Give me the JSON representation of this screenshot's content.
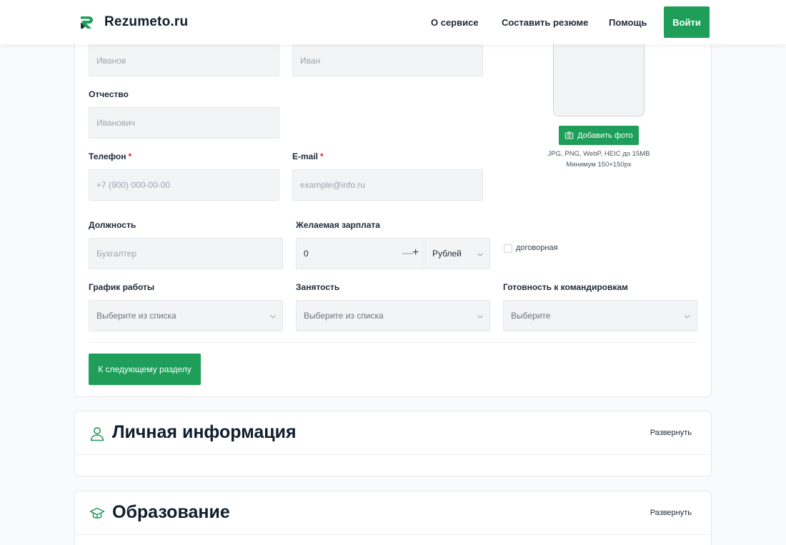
{
  "header": {
    "logo_text": "Rezumeto.ru",
    "nav": [
      "О сервисе",
      "Составить резюме",
      "Помощь"
    ],
    "login_label": "Войти"
  },
  "form": {
    "last_name": {
      "placeholder": "Иванов"
    },
    "first_name": {
      "placeholder": "Иван"
    },
    "middle_name": {
      "label": "Отчество",
      "placeholder": "Иванович"
    },
    "phone": {
      "label": "Телефон",
      "required": "*",
      "placeholder": "+7 (900) 000-00-00"
    },
    "email": {
      "label": "E-mail",
      "required": "*",
      "placeholder": "example@info.ru"
    },
    "position": {
      "label": "Должность",
      "placeholder": "Бухгалтер"
    },
    "salary": {
      "label": "Желаемая зарплата",
      "value": "0",
      "minus": "—",
      "plus": "+",
      "currency": "Рублей"
    },
    "negotiable_label": "договорная",
    "schedule": {
      "label": "График работы",
      "value": "Выберите из списка"
    },
    "employment": {
      "label": "Занятость",
      "value": "Выберите из списка"
    },
    "travel": {
      "label": "Готовность к командировкам",
      "value": "Выберите"
    },
    "next_label": "К следующему разделу"
  },
  "photo": {
    "button_label": "Добавить фото",
    "hint_formats": "JPG, PNG, WebP, HEIC до 15MB",
    "hint_size": "Минимум 150×150px"
  },
  "sections": [
    {
      "title": "Личная информация",
      "toggle": "Развернуть",
      "icon": "user-icon"
    },
    {
      "title": "Образование",
      "toggle": "Развернуть",
      "icon": "graduation-cap-icon"
    }
  ],
  "colors": {
    "accent": "#1e9e58",
    "required": "#dc2626"
  }
}
